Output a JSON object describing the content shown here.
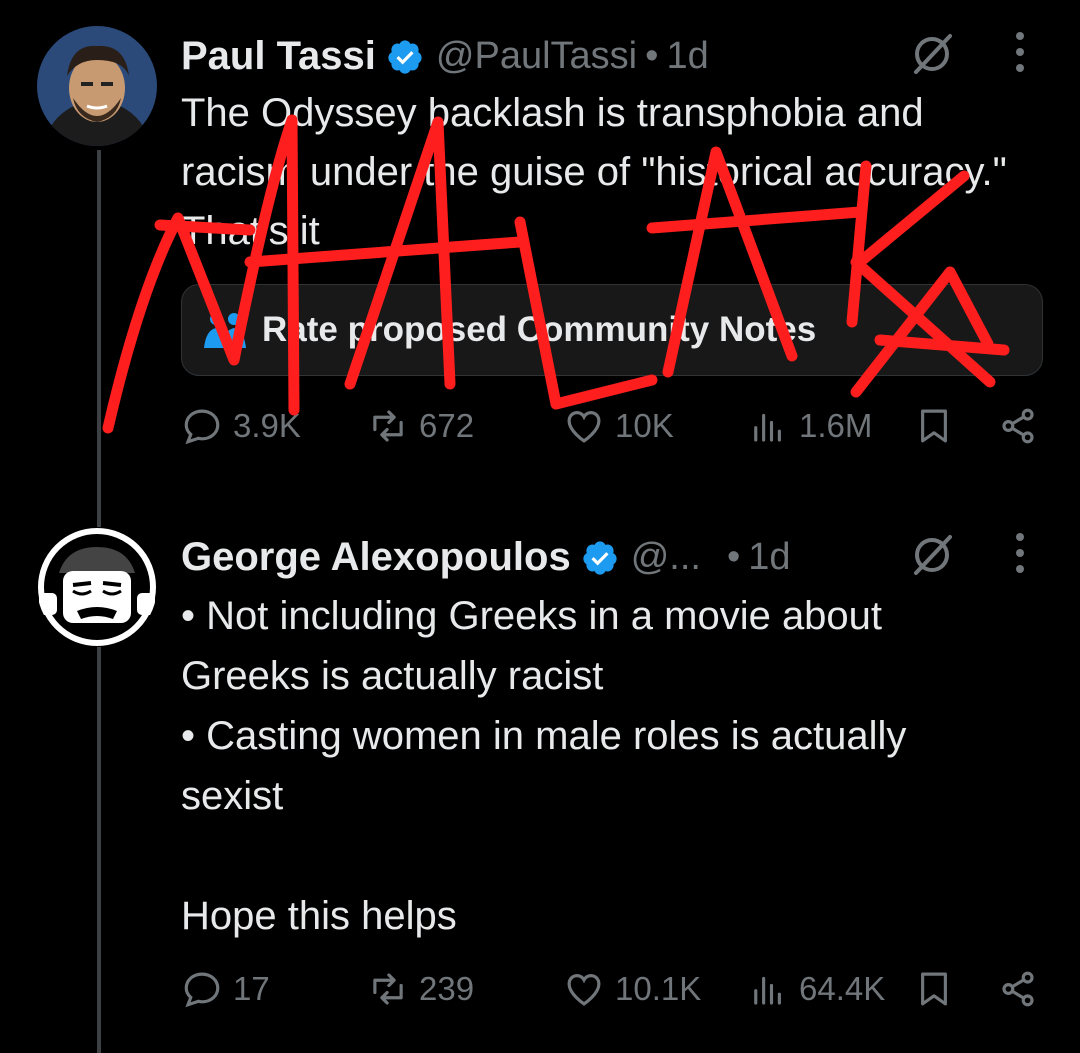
{
  "tweets": [
    {
      "name": "Paul Tassi",
      "handle": "@PaulTassi",
      "dot": "•",
      "time": "1d",
      "text": "The Odyssey backlash is transphobia and racism under the guise of \"historical accuracy.\" That's it",
      "community_note": {
        "icon": "community-notes-icon",
        "label": "Rate proposed Community Notes"
      },
      "stats": {
        "replies": "3.9K",
        "reposts": "672",
        "likes": "10K",
        "views": "1.6M"
      }
    },
    {
      "name": "George Alexopoulos",
      "handle": "@...",
      "dot": "•",
      "time": "1d",
      "text_lines": [
        "• Not including Greeks in a movie about",
        "Greeks is actually racist",
        "• Casting women in male roles is actually",
        "sexist",
        "",
        "Hope this helps"
      ],
      "stats": {
        "replies": "17",
        "reposts": "239",
        "likes": "10.1K",
        "views": "64.4K"
      }
    }
  ],
  "overlay": {
    "scribble_text": "MALAKA",
    "color": "#ff1e1e"
  },
  "colors": {
    "background": "#000000",
    "text": "#e7e9ea",
    "muted": "#71767b",
    "verified": "#1d9bf0"
  }
}
